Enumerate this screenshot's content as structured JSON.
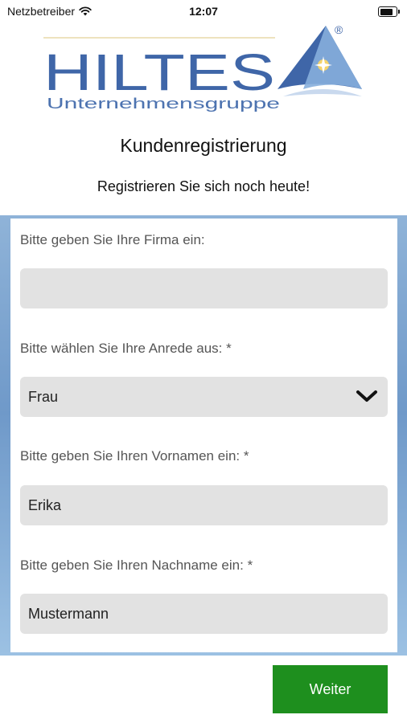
{
  "status_bar": {
    "carrier": "Netzbetreiber",
    "time": "12:07",
    "battery_level": 0.95
  },
  "logo": {
    "wordmark": "HILTES",
    "tagline": "Unternehmensgruppe",
    "registered": "®",
    "colors": {
      "blue": "#3f66a8",
      "light_blue": "#8fb3d8",
      "gold": "#e6b325"
    }
  },
  "header": {
    "title": "Kundenregistrierung",
    "subtitle": "Registrieren Sie sich noch heute!"
  },
  "form": {
    "company": {
      "label": "Bitte geben Sie Ihre Firma ein:",
      "value": ""
    },
    "salutation": {
      "label": "Bitte wählen Sie Ihre Anrede aus: *",
      "value": "Frau",
      "icon": "chevron-down-icon"
    },
    "first_name": {
      "label": "Bitte geben Sie Ihren Vornamen ein: *",
      "value": "Erika"
    },
    "last_name": {
      "label": "Bitte geben Sie Ihren Nachname ein: *",
      "value": "Mustermann"
    }
  },
  "actions": {
    "next_label": "Weiter",
    "next_color": "#1e8f1e"
  }
}
